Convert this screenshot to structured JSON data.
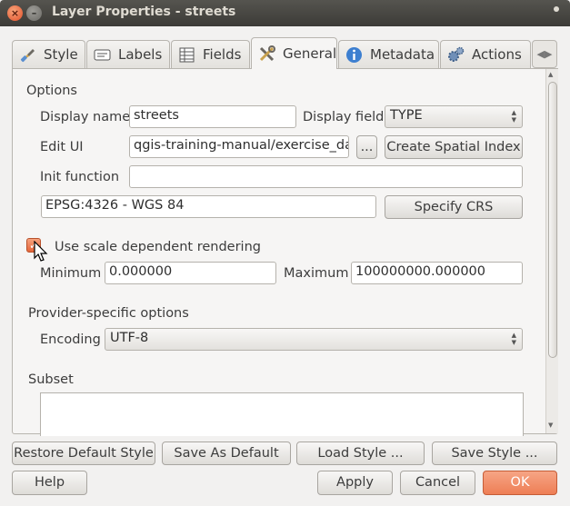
{
  "window": {
    "title": "Layer Properties - streets"
  },
  "tabs": [
    {
      "label": "Style",
      "icon": "brush-icon"
    },
    {
      "label": "Labels",
      "icon": "label-icon"
    },
    {
      "label": "Fields",
      "icon": "table-icon"
    },
    {
      "label": "General",
      "icon": "tools-icon",
      "active": true
    },
    {
      "label": "Metadata",
      "icon": "info-icon"
    },
    {
      "label": "Actions",
      "icon": "gears-icon"
    }
  ],
  "options": {
    "section_title": "Options",
    "display_name_label": "Display name",
    "display_name_value": "streets",
    "display_field_label": "Display field",
    "display_field_value": "TYPE",
    "edit_ui_label": "Edit UI",
    "edit_ui_value": "qgis-training-manual/exercise_data",
    "browse_label": "...",
    "create_spatial_index_label": "Create Spatial Index",
    "init_function_label": "Init function",
    "init_function_value": "",
    "crs_value": "EPSG:4326 - WGS 84",
    "specify_crs_label": "Specify CRS"
  },
  "scale": {
    "checkbox_label": "Use scale dependent rendering",
    "checked": true,
    "minimum_label": "Minimum",
    "minimum_value": "0.000000",
    "maximum_label": "Maximum",
    "maximum_value": "100000000.000000"
  },
  "provider": {
    "section_title": "Provider-specific options",
    "encoding_label": "Encoding",
    "encoding_value": "UTF-8"
  },
  "subset": {
    "section_title": "Subset"
  },
  "footer": {
    "restore_default_style": "Restore Default Style",
    "save_as_default": "Save As Default",
    "load_style": "Load Style ...",
    "save_style": "Save Style ...",
    "help": "Help",
    "apply": "Apply",
    "cancel": "Cancel",
    "ok": "OK"
  },
  "colors": {
    "accent": "#ee7e55",
    "titlebar": "#3c3b37"
  }
}
